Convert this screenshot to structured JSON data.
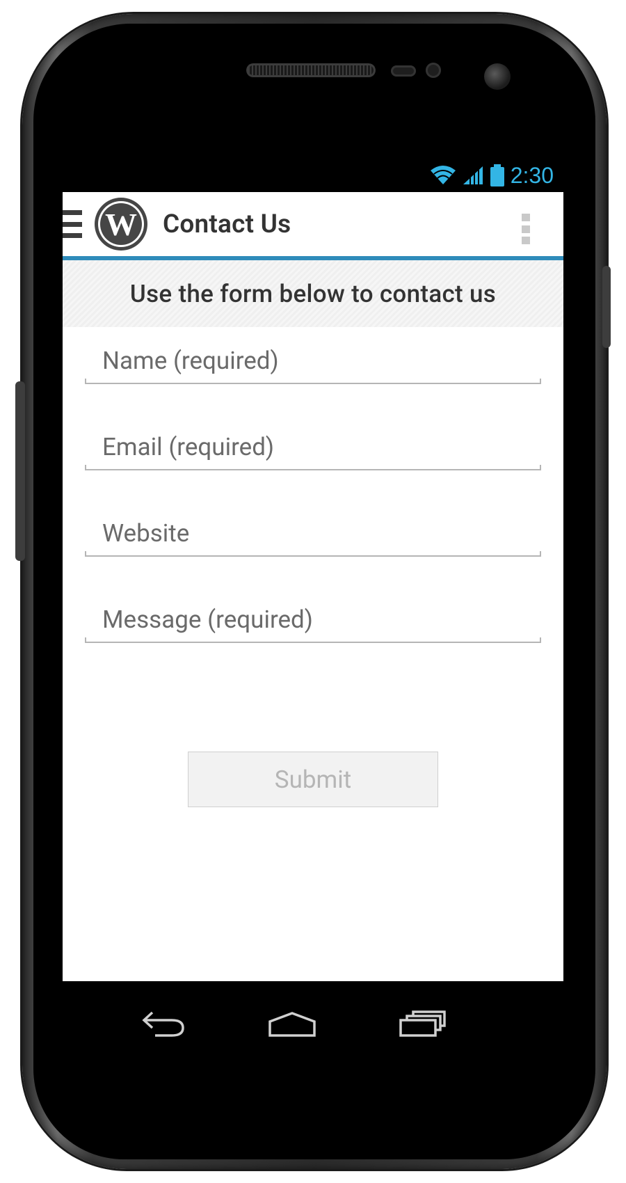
{
  "status_bar": {
    "time": "2:30",
    "icons": [
      "wifi-icon",
      "cell-signal-icon",
      "battery-icon"
    ],
    "accent_color": "#33b5e5"
  },
  "action_bar": {
    "title": "Contact Us",
    "icons": [
      "navigation-drawer-icon",
      "wordpress-logo",
      "overflow-menu-icon"
    ],
    "accent_color": "#2e8bba"
  },
  "banner": {
    "text": "Use the form below to contact us"
  },
  "form": {
    "fields": [
      {
        "placeholder": "Name (required)",
        "value": ""
      },
      {
        "placeholder": "Email (required)",
        "value": ""
      },
      {
        "placeholder": "Website",
        "value": ""
      },
      {
        "placeholder": "Message (required)",
        "value": ""
      }
    ],
    "submit_label": "Submit"
  },
  "nav_bar": {
    "icons": [
      "back-icon",
      "home-icon",
      "recent-apps-icon"
    ]
  }
}
